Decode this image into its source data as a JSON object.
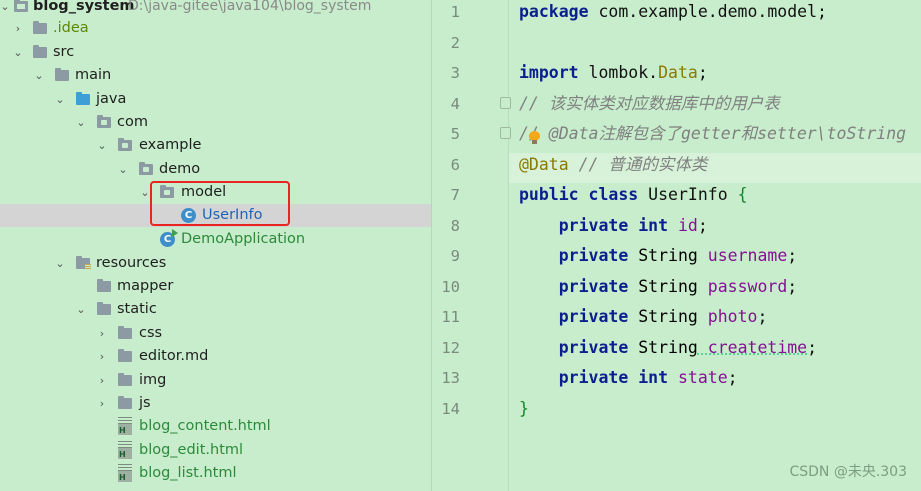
{
  "tree": {
    "project": {
      "name": "blog_system",
      "path": "D:\\java-gitee\\java104\\blog_system"
    },
    "items": [
      {
        "label": "blog_system",
        "icon": "project-folder-icon",
        "arrow": "chevron-down-icon"
      },
      {
        "label": ".idea",
        "icon": "folder-icon",
        "arrow": "chevron-right-icon"
      },
      {
        "label": "src",
        "icon": "folder-icon",
        "arrow": "chevron-down-icon"
      },
      {
        "label": "main",
        "icon": "folder-icon",
        "arrow": "chevron-down-icon"
      },
      {
        "label": "java",
        "icon": "source-folder-icon",
        "arrow": "chevron-down-icon"
      },
      {
        "label": "com",
        "icon": "package-icon",
        "arrow": "chevron-down-icon"
      },
      {
        "label": "example",
        "icon": "package-icon",
        "arrow": "chevron-down-icon"
      },
      {
        "label": "demo",
        "icon": "package-icon",
        "arrow": "chevron-down-icon"
      },
      {
        "label": "model",
        "icon": "package-icon",
        "arrow": "chevron-down-icon"
      },
      {
        "label": "UserInfo",
        "icon": "class-icon"
      },
      {
        "label": "DemoApplication",
        "icon": "spring-class-icon"
      },
      {
        "label": "resources",
        "icon": "resources-folder-icon",
        "arrow": "chevron-down-icon"
      },
      {
        "label": "mapper",
        "icon": "folder-icon"
      },
      {
        "label": "static",
        "icon": "folder-icon",
        "arrow": "chevron-down-icon"
      },
      {
        "label": "css",
        "icon": "folder-icon",
        "arrow": "chevron-right-icon"
      },
      {
        "label": "editor.md",
        "icon": "folder-icon",
        "arrow": "chevron-right-icon"
      },
      {
        "label": "img",
        "icon": "folder-icon",
        "arrow": "chevron-right-icon"
      },
      {
        "label": "js",
        "icon": "folder-icon",
        "arrow": "chevron-right-icon"
      },
      {
        "label": "blog_content.html",
        "icon": "html-file-icon"
      },
      {
        "label": "blog_edit.html",
        "icon": "html-file-icon"
      },
      {
        "label": "blog_list.html",
        "icon": "html-file-icon"
      }
    ],
    "selected": "UserInfo"
  },
  "editor": {
    "line_numbers": [
      "1",
      "2",
      "3",
      "4",
      "5",
      "6",
      "7",
      "8",
      "9",
      "10",
      "11",
      "12",
      "13",
      "14"
    ],
    "code": {
      "l1_kw": "package",
      "l1_rest": " com.example.demo.model;",
      "l3_kw": "import",
      "l3_pkg": " lombok.",
      "l3_cls": "Data",
      "l3_semi": ";",
      "l4_comment": "// 该实体类对应数据库中的用户表",
      "l5_comment_a": "/",
      "l5_comment_b": "/",
      "l5_comment_c": " @Data注解包含了getter和setter\\toString",
      "l6_anno": "@Data",
      "l6_comment": " // 普通的实体类",
      "l7_kw": "public class",
      "l7_name": " UserInfo ",
      "l7_brace": "{",
      "fields": [
        {
          "mod": "private",
          "type": " int",
          "name": " id",
          "end": ";"
        },
        {
          "mod": "private",
          "type": " String",
          "name": " username",
          "end": ";"
        },
        {
          "mod": "private",
          "type": " String",
          "name": " password",
          "end": ";"
        },
        {
          "mod": "private",
          "type": " String",
          "name": " photo",
          "end": ";"
        },
        {
          "mod": "private",
          "type": " String",
          "name": " createtime",
          "end": ";"
        },
        {
          "mod": "private",
          "type": " int",
          "name": " state",
          "end": ";"
        }
      ],
      "l14_brace": "}"
    }
  },
  "watermark": "CSDN @未央.303",
  "colors": {
    "background": "#c7edcc",
    "highlight_box": "#e8261f",
    "keyword": "#0b1f8f",
    "field": "#871094"
  }
}
